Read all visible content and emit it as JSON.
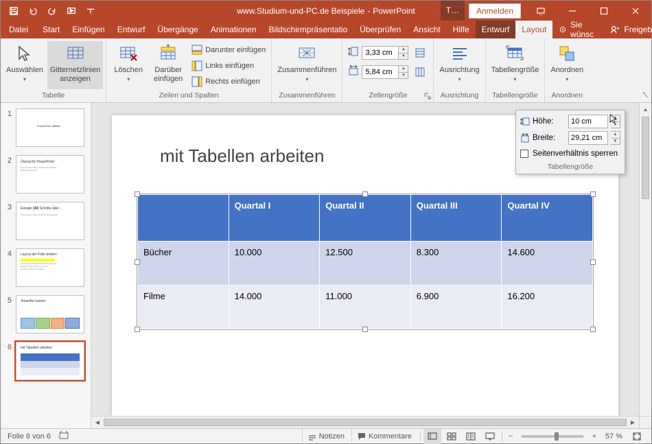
{
  "titlebar": {
    "doc": "www.Studium-und-PC.de Beispiele",
    "sep": "-",
    "app": "PowerPoint",
    "tool_tab_short": "T…",
    "signin": "Anmelden"
  },
  "tabs": {
    "file": "Datei",
    "items": [
      "Start",
      "Einfügen",
      "Entwurf",
      "Übergänge",
      "Animationen",
      "Bildschirmpräsentatio",
      "Überprüfen",
      "Ansicht",
      "Hilfe"
    ],
    "ctx": [
      "Entwurf",
      "Layout"
    ],
    "tell_me": "Sie wünsc",
    "share": "Freigeben"
  },
  "ribbon": {
    "g_table": {
      "label": "Tabelle",
      "select": "Auswählen",
      "grid": "Gitternetzlinien\nanzeigen"
    },
    "g_rowscols": {
      "label": "Zeilen und Spalten",
      "delete": "Löschen",
      "above": "Darüber\neinfügen",
      "below": "Darunter einfügen",
      "left": "Links einfügen",
      "right": "Rechts einfügen"
    },
    "g_merge": {
      "label": "Zusammenführen",
      "merge": "Zusammenführen"
    },
    "g_cellsize": {
      "label": "Zellengröße",
      "height": "3,33 cm",
      "width": "5,84 cm"
    },
    "g_align": {
      "label": "Ausrichtung",
      "btn": "Ausrichtung"
    },
    "g_tablesize": {
      "label": "Tabellengröße",
      "btn": "Tabellengröße"
    },
    "g_arrange": {
      "label": "Anordnen",
      "btn": "Anordnen"
    }
  },
  "popup": {
    "height_label": "Höhe:",
    "height_value": "10 cm",
    "width_label": "Breite:",
    "width_value": "29,21 cm",
    "lock": "Seitenverhältnis sperren",
    "glabel": "Tabellengröße"
  },
  "slide": {
    "title": "mit Tabellen arbeiten",
    "table": {
      "headers": [
        "",
        "Quartal I",
        "Quartal II",
        "Quartal III",
        "Quartal IV"
      ],
      "rows": [
        [
          "Bücher",
          "10.000",
          "12.500",
          "8.300",
          "14.600"
        ],
        [
          "Filme",
          "14.000",
          "11.000",
          "6.900",
          "16.200"
        ]
      ]
    }
  },
  "thumbs": {
    "count": 6,
    "selected": 6
  },
  "status": {
    "slide_of": "Folie 6 von 6",
    "notes": "Notizen",
    "comments": "Kommentare",
    "zoom": "57 %"
  }
}
